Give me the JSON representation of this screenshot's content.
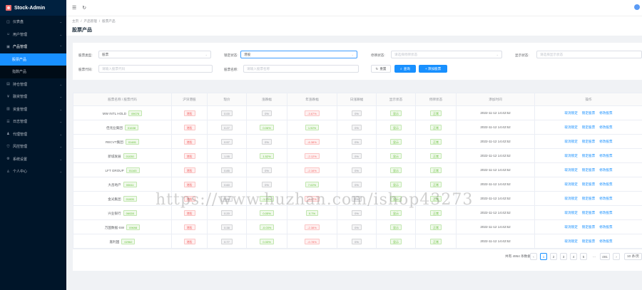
{
  "app": {
    "title": "Stock-Admin"
  },
  "sidebar": {
    "items": [
      {
        "label": "仪表盘",
        "icon": "dashboard-icon"
      },
      {
        "label": "用户管理",
        "icon": "user-icon"
      },
      {
        "label": "产品管理",
        "icon": "box-icon",
        "open": true,
        "children": [
          {
            "label": "股票产品",
            "active": true
          },
          {
            "label": "指数产品"
          }
        ]
      },
      {
        "label": "持仓管理",
        "icon": "briefcase-icon"
      },
      {
        "label": "融资管理",
        "icon": "money-icon"
      },
      {
        "label": "资金管理",
        "icon": "wallet-icon"
      },
      {
        "label": "日志管理",
        "icon": "log-icon"
      },
      {
        "label": "代理管理",
        "icon": "agent-icon"
      },
      {
        "label": "风控管理",
        "icon": "shield-icon"
      },
      {
        "label": "系统设置",
        "icon": "gear-icon"
      },
      {
        "label": "个人中心",
        "icon": "person-icon"
      }
    ]
  },
  "breadcrumb": [
    "主页",
    "/",
    "产品管理",
    "/",
    "股票产品"
  ],
  "page_title": "股票产品",
  "filters": {
    "stock_type_label": "股票类型:",
    "stock_type_value": "股票",
    "lock_label": "锁定状态:",
    "lock_value": "港股",
    "trade_status_label": "停牌状态:",
    "trade_status_placeholder": "请选择停牌状态",
    "display_status_label": "显示状态:",
    "display_status_placeholder": "请选择显示状态",
    "code_label": "股票代码:",
    "code_placeholder": "请输入股票代码",
    "name_label": "股票名称:",
    "name_placeholder": "请输入股票名称",
    "reset_label": "重置",
    "search_label": "查询",
    "add_label": "+ 添加股票"
  },
  "table": {
    "headers": [
      "股票名称 / 股票代码",
      "沪深港股",
      "现价",
      "涨跌幅",
      "年涨跌幅",
      "日涨跌幅",
      "显示状态",
      "停牌状态",
      "添加时间",
      "操作"
    ],
    "rows": [
      {
        "name": "MW INTL HOLD",
        "code": "09076",
        "market": "港股",
        "price": "0.00",
        "chg": "0%",
        "year": "-3.67%",
        "day": "0%",
        "show": "显示",
        "stop": "正常",
        "time": "2022-11-12 14:42:52"
      },
      {
        "name": "佳兆业集团",
        "code": "01638",
        "market": "港股",
        "price": "0.27",
        "chg": "0.06%",
        "year": "1.92%",
        "day": "0%",
        "show": "显示",
        "stop": "正常",
        "time": "2022-11-12 14:42:52"
      },
      {
        "name": "RECVT集团",
        "code": "01481",
        "market": "港股",
        "price": "0.57",
        "chg": "0%",
        "year": "-6.38%",
        "day": "0%",
        "show": "显示",
        "stop": "正常",
        "time": "2022-11-12 14:42:52"
      },
      {
        "name": "新城发展",
        "code": "01030",
        "market": "港股",
        "price": "1.95",
        "chg": "1.52%",
        "year": "-2.12%",
        "day": "0%",
        "show": "显示",
        "stop": "正常",
        "time": "2022-11-12 14:42:52"
      },
      {
        "name": "LFT GROUP",
        "code": "01163",
        "market": "港股",
        "price": "0.85",
        "chg": "0%",
        "year": "-2.16%",
        "day": "0%",
        "show": "显示",
        "stop": "正常",
        "time": "2022-11-12 14:42:52"
      },
      {
        "name": "大昌地产",
        "code": "00611",
        "market": "港股",
        "price": "0.60",
        "chg": "0%",
        "year": "7.02%",
        "day": "0%",
        "show": "显示",
        "stop": "正常",
        "time": "2022-11-12 14:42:52"
      },
      {
        "name": "金光集团",
        "code": "01005",
        "market": "港股",
        "price": "0.46",
        "chg": "-1.23%",
        "year": "-4.17%",
        "day": "0%",
        "show": "显示",
        "stop": "正常",
        "time": "2022-11-12 14:42:52"
      },
      {
        "name": "兴业银行",
        "code": "06028",
        "market": "港股",
        "price": "0.20",
        "chg": "0.05%",
        "year": "0.7%",
        "day": "0%",
        "show": "显示",
        "stop": "正常",
        "time": "2022-11-12 14:42:52"
      },
      {
        "name": "万国数据-SW",
        "code": "09698",
        "market": "港股",
        "price": "0.38",
        "chg": "-0.03%",
        "year": "-2.38%",
        "day": "0%",
        "show": "显示",
        "stop": "正常",
        "time": "2022-11-12 14:42:52"
      },
      {
        "name": "嘉利国",
        "code": "02962",
        "market": "港股",
        "price": "0.77",
        "chg": "0.33%",
        "year": "-0.78%",
        "day": "0%",
        "show": "显示",
        "stop": "正常",
        "time": "2022-11-12 14:42:52"
      }
    ],
    "actions": [
      "取消锁定",
      "锁定股票",
      "修改股票"
    ]
  },
  "pager": {
    "total": "共有 4954 条数据",
    "prev": "‹",
    "pages": [
      "1",
      "2",
      "3",
      "4",
      "5"
    ],
    "ellipsis": "···",
    "last": "491",
    "next": "›",
    "page_size": "10 条/页"
  },
  "watermark": "https://www.huzhan.com/ishop43273"
}
